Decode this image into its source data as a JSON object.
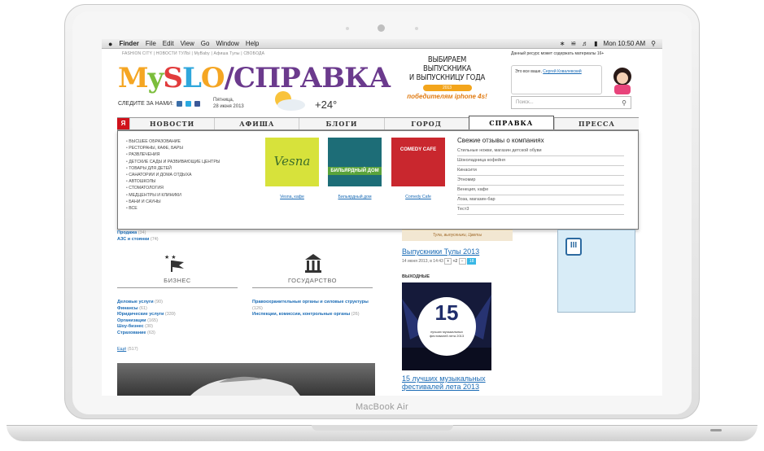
{
  "device": {
    "brand": "MacBook Air"
  },
  "menubar": {
    "apple": "",
    "items": [
      "Finder",
      "File",
      "Edit",
      "View",
      "Go",
      "Window",
      "Help"
    ],
    "clock": "Mon 10:50 AM"
  },
  "site": {
    "topnav": "FASHION CITY  |  НОВОСТИ ТУЛЫ  |  MyBaby  |  Афиша Тулы  |  СВОБОДА",
    "warning": "Данный ресурс может содержать материалы 16+",
    "logo_text": "MySLO",
    "logo_slash": "/СПРАВКА",
    "follow_label": "СЛЕДИТЕ ЗА НАМИ:",
    "date_line1": "Пятница,",
    "date_line2": "28 июня 2013",
    "temperature": "+24°",
    "ad": {
      "line1": "ВЫБИРАЕМ ВЫПУСКНИКА",
      "line2": "И ВЫПУСКНИЦУ ГОДА",
      "ribbon": "2013",
      "line3": "победителям iphone 4s!"
    },
    "user": {
      "text": "Это все ваше,",
      "link": "Сергей Ковалевский"
    },
    "search": {
      "placeholder": "Поиск..."
    }
  },
  "nav": {
    "ya": "Я",
    "tabs": [
      "НОВОСТИ",
      "АФИША",
      "БЛОГИ",
      "ГОРОД",
      "СПРАВКА",
      "ПРЕССА"
    ],
    "active": "СПРАВКА"
  },
  "dropdown": {
    "categories": [
      "ВЫСШЕЕ ОБРАЗОВАНИЕ",
      "РЕСТОРАНЫ, КАФЕ, БАРЫ",
      "РАЗВЛЕЧЕНИЯ",
      "ДЕТСКИЕ САДЫ И РАЗВИВАЮЩИЕ ЦЕНТРЫ",
      "ТОВАРЫ ДЛЯ ДЕТЕЙ",
      "САНАТОРИИ И ДОМА ОТДЫХА",
      "АВТОШКОЛЫ",
      "СТОМАТОЛОГИЯ",
      "МЕДЦЕНТРЫ И КЛИНИКИ",
      "БАНИ И САУНЫ",
      "ВСЕ"
    ],
    "places": [
      {
        "caption": "Vesna, кафе",
        "img_text": "Vesna",
        "color": "#d7e23b"
      },
      {
        "caption": "Бильярдный дом",
        "img_text": "БИЛЬЯРДНЫЙ ДОМ",
        "color": "#1d6d77"
      },
      {
        "caption": "Comedy Cafe",
        "img_text": "COMEDY CAFE",
        "color": "#c9272e"
      }
    ],
    "reviews_title": "Свежие отзывы о компаниях",
    "reviews": [
      "Стильные ножки, магазин детской обуви",
      "Шоколадница кофейня",
      "Кинасити",
      "Этномир",
      "Венеция, кафе",
      "Лоза, магазин-бар",
      "Тест3"
    ]
  },
  "lower": {
    "top_links": [
      {
        "name": "Продажа",
        "count": "(34)"
      },
      {
        "name": "АЗС и стоянки",
        "count": "(74)"
      }
    ],
    "business": {
      "title": "БИЗНЕС",
      "links": [
        {
          "name": "Деловые услуги",
          "count": "(90)"
        },
        {
          "name": "Финансы",
          "count": "(61)"
        },
        {
          "name": "Юридические услуги",
          "count": "(339)"
        },
        {
          "name": "Организации",
          "count": "(165)"
        },
        {
          "name": "Шоу-бизнес",
          "count": "(30)"
        },
        {
          "name": "Страхование",
          "count": "(63)"
        }
      ]
    },
    "state": {
      "title": "ГОСУДАРСТВО",
      "links": [
        {
          "name": "Правоохранительные органы и силовые структуры",
          "count": "(126)"
        },
        {
          "name": "Инспекции, комиссии, контрольные органы",
          "count": "(26)"
        }
      ]
    },
    "more": {
      "label": "Ещё",
      "count": "(517)"
    },
    "news": {
      "strip_text": "Тула, выпускники, Цветы",
      "title": "Выпускники Тулы 2013",
      "meta": "14 июня 2013, в 14:43",
      "plus": "+",
      "score": "+2",
      "minus": "−",
      "comments": "18",
      "weekend_label": "ВЫХОДНЫЕ",
      "fest_number": "15",
      "fest_caption": "лучших музыкальных фестивалей лета 2013",
      "fest_title": "15 лучших музыкальных фестивалей лета 2013"
    }
  }
}
